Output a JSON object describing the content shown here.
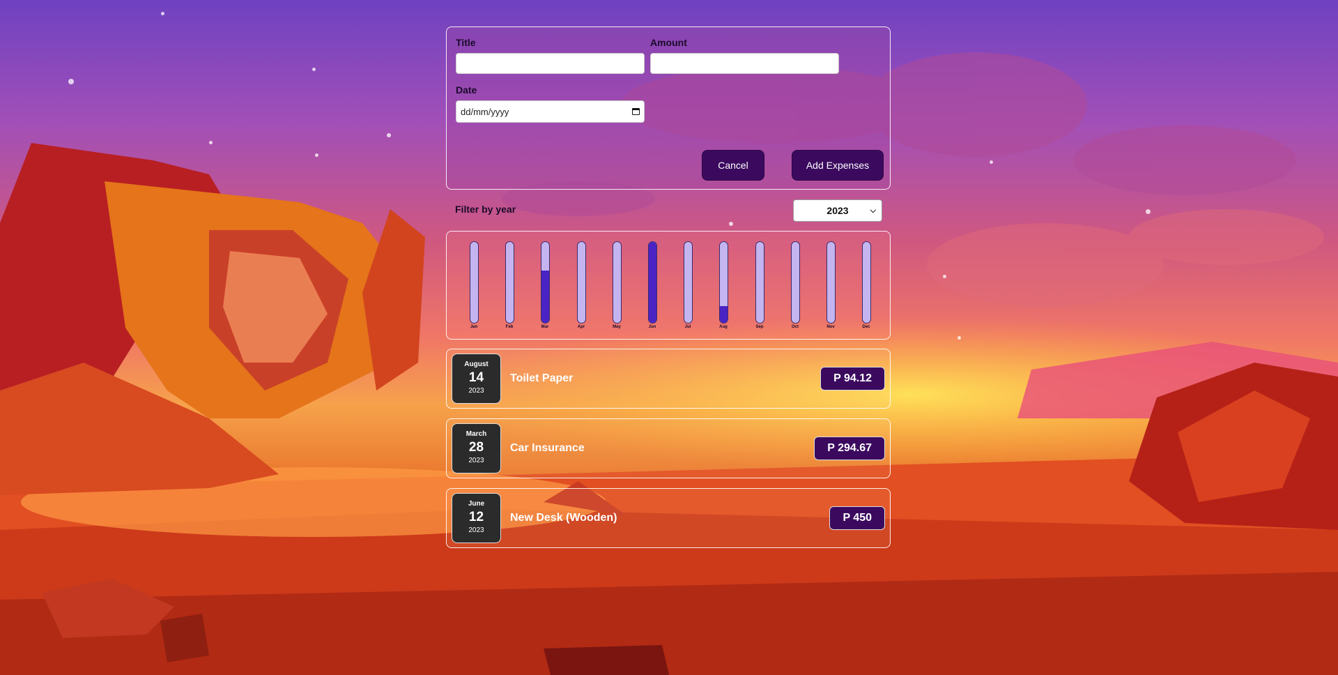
{
  "form": {
    "title_label": "Title",
    "title_value": "",
    "amount_label": "Amount",
    "amount_value": "",
    "date_label": "Date",
    "date_placeholder": "dd/mm/yyyy",
    "cancel_label": "Cancel",
    "add_label": "Add Expenses"
  },
  "filter": {
    "label": "Filter by year",
    "selected_year": "2023"
  },
  "chart": {
    "months": [
      {
        "label": "Jan",
        "fill": 0
      },
      {
        "label": "Feb",
        "fill": 0
      },
      {
        "label": "Mar",
        "fill": 0.65
      },
      {
        "label": "Apr",
        "fill": 0
      },
      {
        "label": "May",
        "fill": 0
      },
      {
        "label": "Jun",
        "fill": 1.0
      },
      {
        "label": "Jul",
        "fill": 0
      },
      {
        "label": "Aug",
        "fill": 0.21
      },
      {
        "label": "Sep",
        "fill": 0
      },
      {
        "label": "Oct",
        "fill": 0
      },
      {
        "label": "Nov",
        "fill": 0
      },
      {
        "label": "Dec",
        "fill": 0
      }
    ]
  },
  "expenses": [
    {
      "month": "August",
      "day": "14",
      "year": "2023",
      "title": "Toilet Paper",
      "amount": "P 94.12"
    },
    {
      "month": "March",
      "day": "28",
      "year": "2023",
      "title": "Car Insurance",
      "amount": "P 294.67"
    },
    {
      "month": "June",
      "day": "12",
      "year": "2023",
      "title": "New Desk (Wooden)",
      "amount": "P 450"
    }
  ],
  "colors": {
    "button": "#3b0a5f",
    "bar_fill": "#4a23c4",
    "bar_track": "#c4b5f0"
  }
}
